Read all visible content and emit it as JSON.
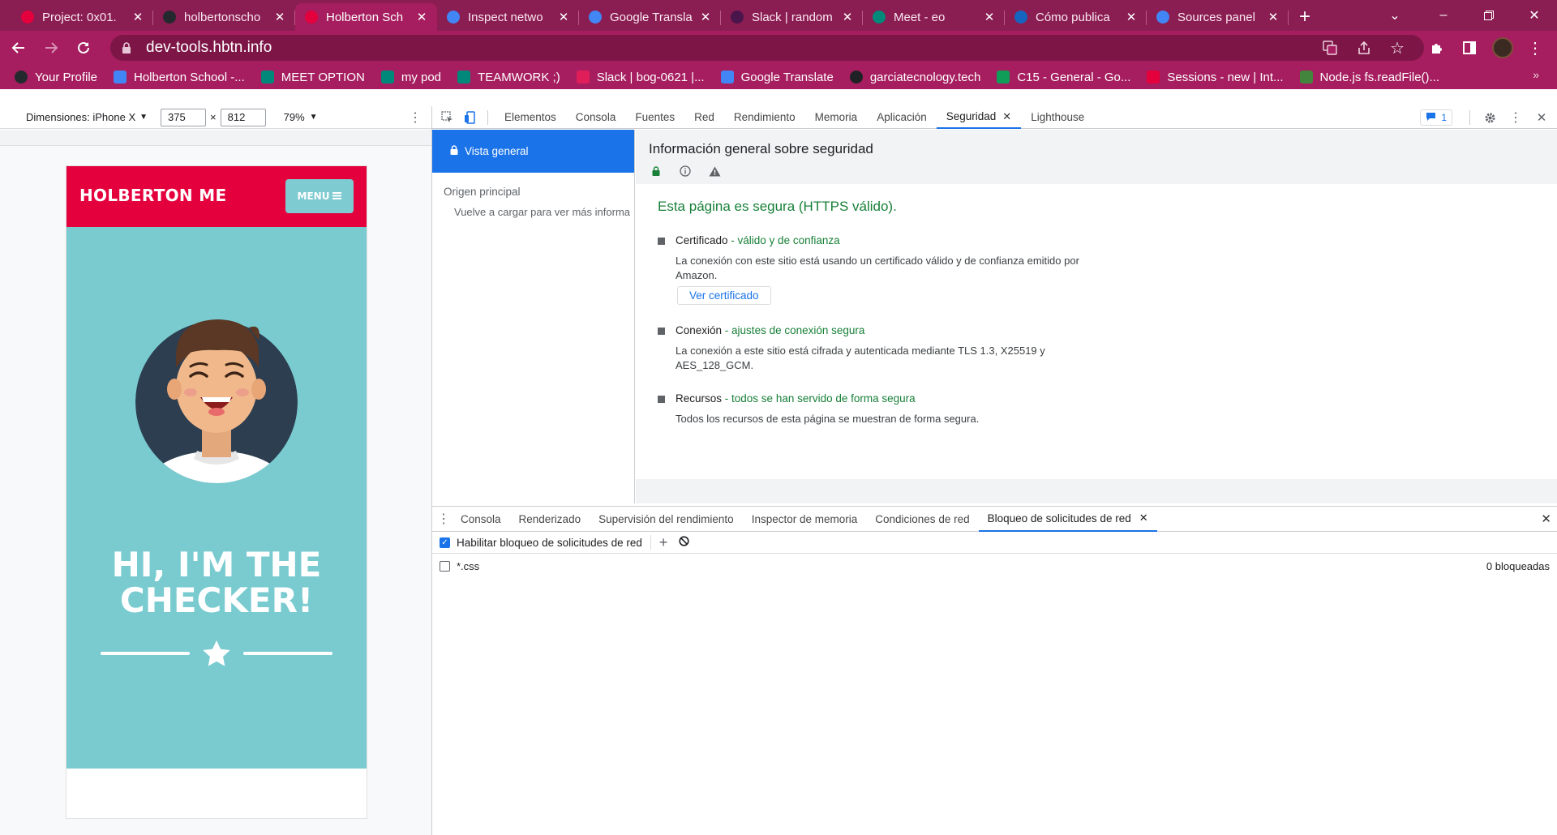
{
  "browser": {
    "tabs": [
      {
        "title": "Project: 0x01.",
        "icon": "holberton-icon",
        "color": "#e4003d",
        "active": false
      },
      {
        "title": "holbertonscho",
        "icon": "github-icon",
        "color": "#24292e",
        "active": false
      },
      {
        "title": "Holberton Sch",
        "icon": "holberton-icon",
        "color": "#e4003d",
        "active": true
      },
      {
        "title": "Inspect netwo",
        "icon": "chrome-icon",
        "color": "#4285f4",
        "active": false
      },
      {
        "title": "Google Transla",
        "icon": "google-translate-icon",
        "color": "#4285f4",
        "active": false
      },
      {
        "title": "Slack | random",
        "icon": "slack-icon",
        "color": "#4a154b",
        "active": false
      },
      {
        "title": "Meet - eo",
        "icon": "meet-icon",
        "color": "#00897b",
        "active": false
      },
      {
        "title": "Cómo publica",
        "icon": "powershell-icon",
        "color": "#1565c0",
        "active": false
      },
      {
        "title": "Sources panel",
        "icon": "chrome-icon",
        "color": "#4285f4",
        "active": false
      }
    ],
    "url": "dev-tools.hbtn.info",
    "bookmarks": [
      {
        "label": "Your Profile",
        "icon": "github-icon",
        "color": "#24292e"
      },
      {
        "label": "Holberton School -...",
        "icon": "calendar-icon",
        "color": "#4285f4"
      },
      {
        "label": "MEET OPTION",
        "icon": "meet-icon",
        "color": "#00897b"
      },
      {
        "label": "my pod",
        "icon": "meet-icon",
        "color": "#00897b"
      },
      {
        "label": "TEAMWORK ;)",
        "icon": "meet-icon",
        "color": "#00897b"
      },
      {
        "label": "Slack | bog-0621 |...",
        "icon": "slack-icon",
        "color": "#e01e5a"
      },
      {
        "label": "Google Translate",
        "icon": "google-translate-icon",
        "color": "#4285f4"
      },
      {
        "label": "garciatecnology.tech",
        "icon": "globe-icon",
        "color": "#202124"
      },
      {
        "label": "C15 - General - Go...",
        "icon": "sheets-icon",
        "color": "#0f9d58"
      },
      {
        "label": "Sessions - new | Int...",
        "icon": "holberton-icon",
        "color": "#e4003d"
      },
      {
        "label": "Node.js fs.readFile()...",
        "icon": "nodejs-icon",
        "color": "#43853d"
      }
    ]
  },
  "device_toolbar": {
    "dimensions_label": "Dimensiones: iPhone X",
    "width": "375",
    "times": "×",
    "height": "812",
    "zoom": "79%"
  },
  "site": {
    "logo": "HOLBERTON ME",
    "menu_label": "MENU",
    "hero_line1": "HI, I'M THE",
    "hero_line2": "CHECKER!"
  },
  "devtools": {
    "tabs": [
      "Elementos",
      "Consola",
      "Fuentes",
      "Red",
      "Rendimiento",
      "Memoria",
      "Aplicación",
      "Seguridad",
      "Lighthouse"
    ],
    "active_tab": "Seguridad",
    "issues_count": "1",
    "security": {
      "sidebar_overview": "Vista general",
      "sidebar_origin_heading": "Origen principal",
      "sidebar_note": "Vuelve a cargar para ver más informa",
      "title": "Información general sobre seguridad",
      "summary": "Esta página es segura (HTTPS válido).",
      "items": [
        {
          "label": "Certificado",
          "status": "válido y de confianza",
          "desc": "La conexión con este sitio está usando un certificado válido y de confianza emitido por Amazon.",
          "button": "Ver certificado"
        },
        {
          "label": "Conexión",
          "status": "ajustes de conexión segura",
          "desc": "La conexión a este sitio está cifrada y autenticada mediante TLS 1.3, X25519 y AES_128_GCM."
        },
        {
          "label": "Recursos",
          "status": "todos se han servido de forma segura",
          "desc": "Todos los recursos de esta página se muestran de forma segura."
        }
      ]
    },
    "drawer": {
      "tabs": [
        "Consola",
        "Renderizado",
        "Supervisión del rendimiento",
        "Inspector de memoria",
        "Condiciones de red",
        "Bloqueo de solicitudes de red"
      ],
      "active_tab": "Bloqueo de solicitudes de red",
      "enable_label": "Habilitar bloqueo de solicitudes de red",
      "enable_checked": true,
      "patterns": [
        {
          "pattern": "*.css",
          "checked": false
        }
      ],
      "blocked_count": "0 bloqueadas"
    }
  },
  "colors": {
    "tabstrip": "#8a1d52",
    "toolbar": "#a61e5f",
    "site_red": "#e4003d",
    "site_teal": "#79cbd0",
    "secure_green": "#188038",
    "devtools_blue": "#1a73e8"
  }
}
